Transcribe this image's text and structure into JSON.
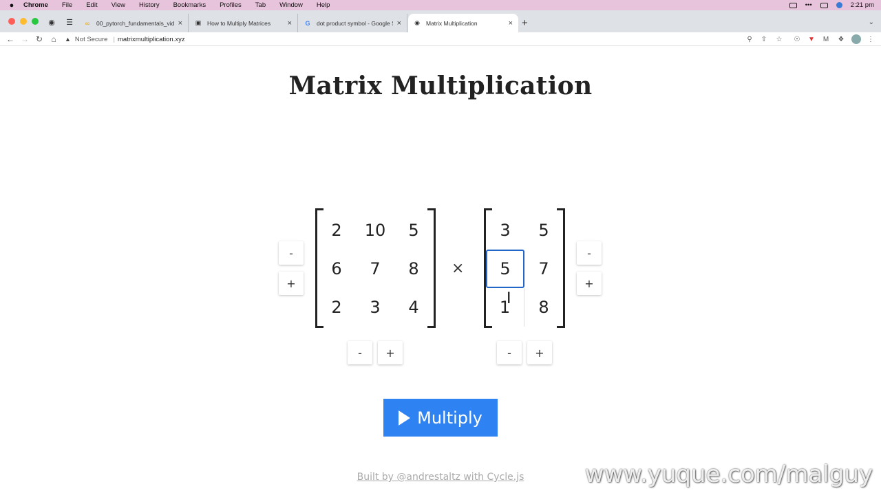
{
  "menubar": {
    "apple": "",
    "items": [
      "Chrome",
      "File",
      "Edit",
      "View",
      "History",
      "Bookmarks",
      "Profiles",
      "Tab",
      "Window",
      "Help"
    ],
    "clock": "2:21 pm"
  },
  "tabs": [
    {
      "title": "00_pytorch_fundamentals_vid",
      "favicon": "colab-icon"
    },
    {
      "title": "How to Multiply Matrices",
      "favicon": "book-icon"
    },
    {
      "title": "dot product symbol - Google S",
      "favicon": "google-icon"
    },
    {
      "title": "Matrix Multiplication",
      "favicon": "globe-icon",
      "active": true
    }
  ],
  "toolbar": {
    "security_label": "Not Secure",
    "url": "matrixmultiplication.xyz"
  },
  "page": {
    "title": "Matrix Multiplication",
    "matrix_a": [
      [
        "2",
        "10",
        "5"
      ],
      [
        "6",
        "7",
        "8"
      ],
      [
        "2",
        "3",
        "4"
      ]
    ],
    "matrix_b": [
      [
        "3",
        "5"
      ],
      [
        "5",
        "7"
      ],
      [
        "1",
        "8"
      ]
    ],
    "times_symbol": "×",
    "minus": "-",
    "plus": "+",
    "multiply_label": "Multiply",
    "footer": "Built by @andrestaltz with Cycle.js"
  },
  "watermark": "www.yuque.com/malguy"
}
